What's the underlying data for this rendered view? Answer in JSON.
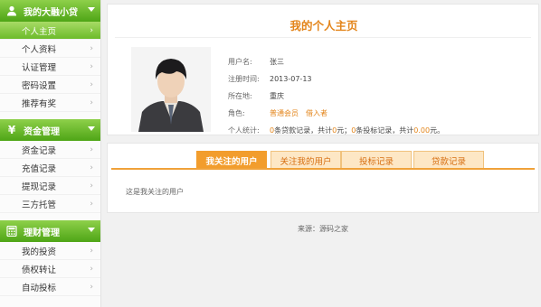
{
  "sidebar": {
    "sections": [
      {
        "title": "我的大融小贷",
        "icon": "user-icon",
        "items": [
          {
            "label": "个人主页",
            "active": true
          },
          {
            "label": "个人资料",
            "active": false
          },
          {
            "label": "认证管理",
            "active": false
          },
          {
            "label": "密码设置",
            "active": false
          },
          {
            "label": "推荐有奖",
            "active": false
          }
        ]
      },
      {
        "title": "资金管理",
        "icon": "yen-icon",
        "items": [
          {
            "label": "资金记录"
          },
          {
            "label": "充值记录"
          },
          {
            "label": "提现记录"
          },
          {
            "label": "三方托管"
          }
        ]
      },
      {
        "title": "理财管理",
        "icon": "calculator-icon",
        "items": [
          {
            "label": "我的投资"
          },
          {
            "label": "债权转让"
          },
          {
            "label": "自动投标"
          }
        ]
      }
    ]
  },
  "profile": {
    "page_title": "我的个人主页",
    "username_label": "用户名:",
    "username": "张三",
    "register_label": "注册时间:",
    "register_date": "2013-07-13",
    "location_label": "所在地:",
    "location": "重庆",
    "role_label": "角色:",
    "role_member": "普通会员",
    "role_borrower": "借入者",
    "stats_label": "个人统计:",
    "stats": {
      "loan_count": "0",
      "loan_text": "条贷款记录，共计",
      "loan_amount": "0",
      "unit_yuan_semi": "元；",
      "bid_count": "0",
      "bid_text": "条投标记录，共计",
      "bid_amount": "0.00",
      "unit_yuan_end": "元。"
    }
  },
  "tabs": {
    "items": [
      {
        "label": "我关注的用户",
        "active": true
      },
      {
        "label": "关注我的用户",
        "active": false
      },
      {
        "label": "投标记录",
        "active": false
      },
      {
        "label": "贷款记录",
        "active": false
      }
    ],
    "content": "这是我关注的用户"
  },
  "footer": {
    "text": "来源：源码之家"
  }
}
